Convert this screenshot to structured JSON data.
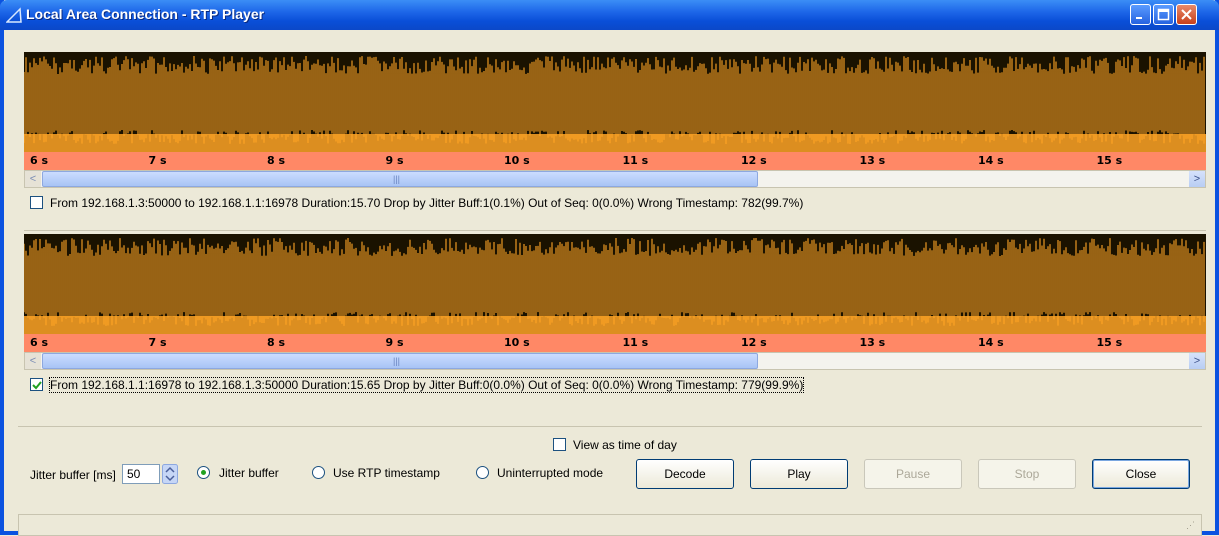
{
  "window": {
    "title": "Local Area Connection - RTP Player",
    "colors": {
      "titlebar": "#0b52e0",
      "waveform_bg": "#1a1200",
      "waveform": "#ffa526",
      "timebar": "#ff8866"
    }
  },
  "streams": [
    {
      "checked": false,
      "label": "From 192.168.1.3:50000 to 192.168.1.1:16978   Duration:15.70   Drop by Jitter Buff:1(0.1%)   Out of Seq: 0(0.0%)   Wrong Timestamp: 782(99.7%)",
      "time_ticks": [
        "6 s",
        "7 s",
        "8 s",
        "9 s",
        "10 s",
        "11 s",
        "12 s",
        "13 s",
        "14 s",
        "15 s"
      ]
    },
    {
      "checked": true,
      "label": "From 192.168.1.1:16978 to 192.168.1.3:50000   Duration:15.65   Drop by Jitter Buff:0(0.0%)   Out of Seq: 0(0.0%)   Wrong Timestamp: 779(99.9%)",
      "time_ticks": [
        "6 s",
        "7 s",
        "8 s",
        "9 s",
        "10 s",
        "11 s",
        "12 s",
        "13 s",
        "14 s",
        "15 s"
      ]
    }
  ],
  "view_time_of_day": {
    "label": "View as time of day",
    "checked": false
  },
  "jitter": {
    "label": "Jitter buffer [ms]",
    "value": "50"
  },
  "modes": [
    {
      "label": "Jitter buffer",
      "selected": true
    },
    {
      "label": "Use RTP timestamp",
      "selected": false
    },
    {
      "label": "Uninterrupted mode",
      "selected": false
    }
  ],
  "buttons": {
    "decode": "Decode",
    "play": "Play",
    "pause": "Pause",
    "stop": "Stop",
    "close": "Close"
  },
  "icons": [
    "app-icon",
    "minimize-icon",
    "maximize-icon",
    "close-icon",
    "scroll-left-icon",
    "scroll-right-icon",
    "spinner-icon"
  ]
}
